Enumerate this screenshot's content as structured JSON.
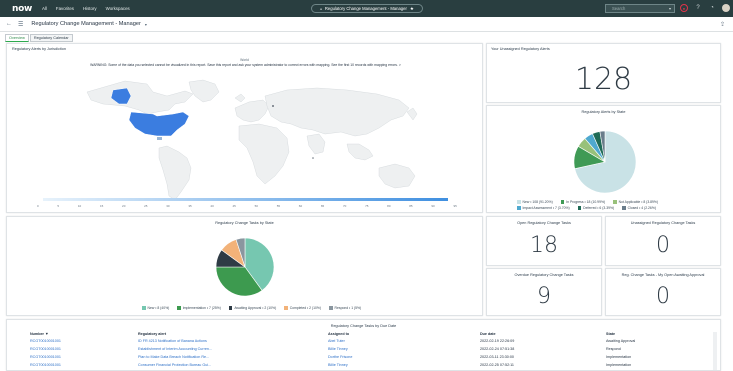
{
  "topnav": {
    "logo": "now",
    "links": [
      "All",
      "Favorites",
      "History",
      "Workspaces"
    ],
    "context": "Regulatory Change Management - Manager",
    "search_placeholder": "Search"
  },
  "header": {
    "title": "Regulatory Change Management - Manager"
  },
  "tabs": [
    "Overview",
    "Regulatory Calendar"
  ],
  "map_widget": {
    "title": "Regulatory Alerts by Jurisdiction",
    "world_label": "World",
    "warning": "WARNING: Some of the data you selected cannot be visualized in this report. Save this report and ask your system administrator to correct errors with mapping. See the first 10 records with mapping errors. >",
    "scale_ticks": [
      "0",
      "5",
      "10",
      "15",
      "20",
      "25",
      "30",
      "35",
      "40",
      "45",
      "50",
      "55",
      "60",
      "65",
      "70",
      "75",
      "80",
      "85",
      "90",
      "95"
    ]
  },
  "unassigned_alerts": {
    "title": "Your Unassigned Regulatory Alerts",
    "value": "128"
  },
  "alerts_by_state": {
    "title": "Regulatory Alerts by State",
    "legend": [
      {
        "label": "New • 108 (91.20%)",
        "color": "#c9e2e6"
      },
      {
        "label": "In Progress • 18 (10.99%)",
        "color": "#3f9a55"
      },
      {
        "label": "Not Applicable • 8 (3.89%)",
        "color": "#98c17a"
      },
      {
        "label": "Impact Assessment • 7 (3.70%)",
        "color": "#4fa9cf"
      },
      {
        "label": "Deferred • 6 (3.39%)",
        "color": "#1f6b56"
      },
      {
        "label": "Closed • 4 (2.26%)",
        "color": "#6a7d8b"
      }
    ]
  },
  "tasks_by_state": {
    "title": "Regulatory Change Tasks by State",
    "legend": [
      {
        "label": "New • 8 (40%)",
        "color": "#76c7b0"
      },
      {
        "label": "Implementation • 7 (25%)",
        "color": "#3d9a4f"
      },
      {
        "label": "Awaiting Approval • 2 (10%)",
        "color": "#2f3b45"
      },
      {
        "label": "Completed • 2 (10%)",
        "color": "#f2b279"
      },
      {
        "label": "Respond • 1 (5%)",
        "color": "#8a969f"
      }
    ]
  },
  "open_tasks": {
    "title": "Open Regulatory Change Tasks",
    "value": "18"
  },
  "unassigned_tasks": {
    "title": "Unassigned Regulatory Change Tasks",
    "value": "0"
  },
  "overdue_tasks": {
    "title": "Overdue Regulatory Change Tasks",
    "value": "9"
  },
  "my_tasks": {
    "title": "Reg. Change Tasks - My Open Awaiting Approval",
    "value": "0"
  },
  "due_table": {
    "title": "Regulatory Change Tasks by Due Date",
    "columns": [
      "Number ▼",
      "Regulatory alert",
      "Assigned to",
      "Due date",
      "State"
    ],
    "rows": [
      [
        "RCGT0010001001",
        "ID FR 4213 Notification of Banana Actions",
        "Abel Tuter",
        "2022-02-19 22:26:09",
        "Awaiting Approval"
      ],
      [
        "RCGT0010001001",
        "Establishment of Interim Accounting Curren...",
        "Billie Tinney",
        "2022-02-24 07:51:38",
        "Respond"
      ],
      [
        "RCGT0010001001",
        "Plan to Make Data Breach Notification Re...",
        "Dorthe Frisone",
        "2022-03-11 23:30:00",
        "Implementation"
      ],
      [
        "RCGT0010001001",
        "Consumer Financial Protection Bureau Gui...",
        "Billie Tinney",
        "2022-02-25 07:52:11",
        "Implementation"
      ]
    ]
  },
  "chart_data": [
    {
      "type": "pie",
      "title": "Regulatory Alerts by State",
      "categories": [
        "New",
        "In Progress",
        "Not Applicable",
        "Impact Assessment",
        "Deferred",
        "Closed"
      ],
      "values": [
        108,
        18,
        8,
        7,
        6,
        4
      ],
      "colors": [
        "#c9e2e6",
        "#3f9a55",
        "#98c17a",
        "#4fa9cf",
        "#1f6b56",
        "#6a7d8b"
      ]
    },
    {
      "type": "pie",
      "title": "Regulatory Change Tasks by State",
      "categories": [
        "New",
        "Implementation",
        "Awaiting Approval",
        "Completed",
        "Respond"
      ],
      "values": [
        8,
        7,
        2,
        2,
        1
      ],
      "colors": [
        "#76c7b0",
        "#3d9a4f",
        "#2f3b45",
        "#f2b279",
        "#8a969f"
      ]
    }
  ]
}
